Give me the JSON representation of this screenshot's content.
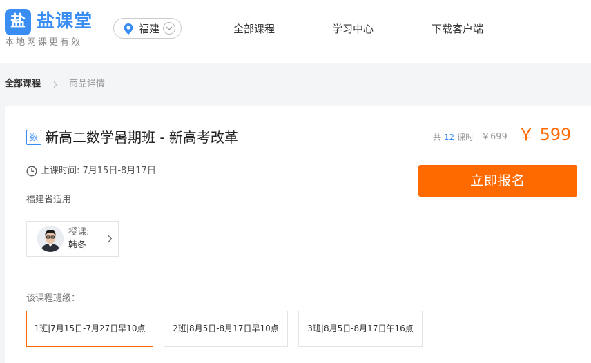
{
  "header": {
    "logo_glyph": "盐",
    "logo_name": "盐课堂",
    "logo_slogan": "本地网课更有效",
    "city": "福建",
    "nav": [
      "全部课程",
      "学习中心",
      "下载客户端"
    ]
  },
  "breadcrumb": {
    "home": "全部课程",
    "current": "商品详情"
  },
  "course": {
    "subject_badge": "数",
    "title": "新高二数学暑期班 - 新高考改革",
    "lessons_prefix": "共",
    "lessons_count": "12",
    "lessons_suffix": "课时",
    "original_price": "￥699",
    "price": "￥ 599",
    "schedule": "上课时间: 7月15日-8月17日",
    "region": "福建省适用",
    "enroll_label": "立即报名",
    "teacher_role": "授课:",
    "teacher_name": "韩冬",
    "classes_label": "该课程班级：",
    "classes": [
      "1班|7月15日-7月27日早10点",
      "2班|8月5日-8月17日早10点",
      "3班|8月5日-8月17日午16点"
    ]
  },
  "colors": {
    "brand": "#3a8ef3",
    "accent": "#ff6a00"
  },
  "icons": [
    "location-pin-icon",
    "chevron-down-icon",
    "chevron-right-icon",
    "clock-icon"
  ]
}
